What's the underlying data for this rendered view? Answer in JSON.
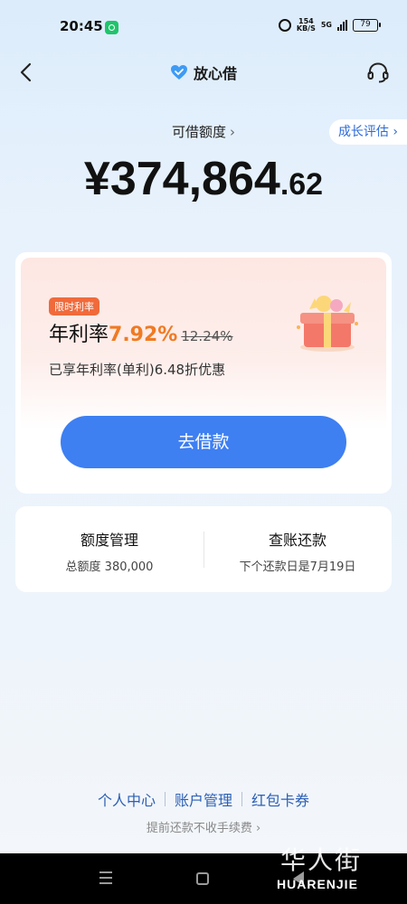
{
  "status_bar": {
    "time": "20:45",
    "net_speed_value": "154",
    "net_speed_unit": "KB/S",
    "network": "5G",
    "battery": "79"
  },
  "nav": {
    "brand": "放心借",
    "brand_color": "#3e9bf5"
  },
  "credit": {
    "label": "可借额度",
    "growth_button": "成长评估",
    "amount_main": "¥374,864",
    "amount_decimal": ".62"
  },
  "promo_card": {
    "tag": "限时利率",
    "rate_label": "年利率",
    "rate_value": "7.92%",
    "rate_old": "12.24%",
    "discount_text": "已享年利率(单利)6.48折优惠",
    "borrow_button": "去借款",
    "accent_color": "#f07a22",
    "button_color": "#3e7ff2"
  },
  "sub_card": {
    "left": {
      "title": "额度管理",
      "desc": "总额度 380,000"
    },
    "right": {
      "title": "查账还款",
      "desc": "下个还款日是7月19日"
    }
  },
  "footer": {
    "links": [
      "个人中心",
      "账户管理",
      "红包卡券"
    ],
    "note": "提前还款不收手续费"
  },
  "watermark": {
    "title": "华人街",
    "sub": "HUARENJIE"
  }
}
